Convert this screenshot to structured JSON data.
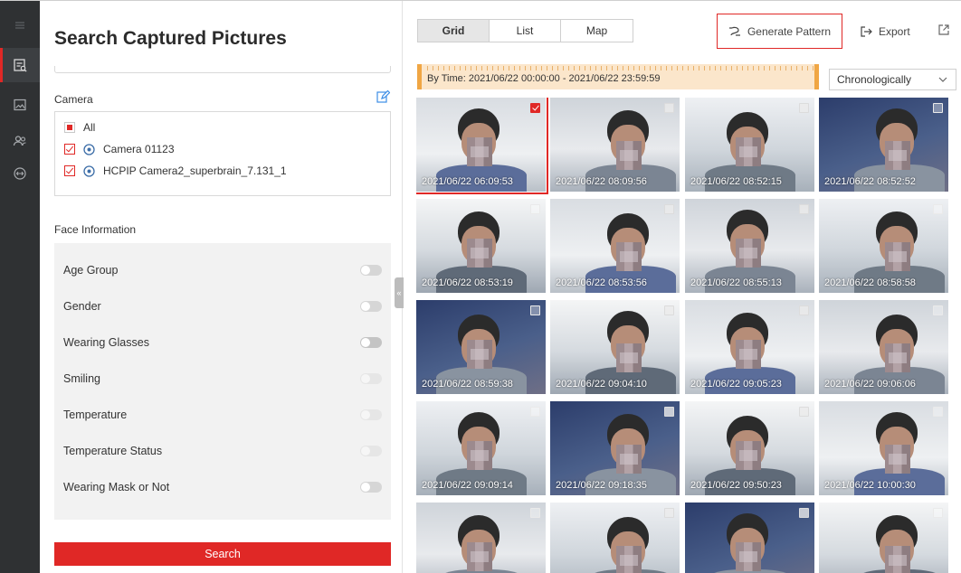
{
  "rail": {
    "items": [
      {
        "icon": "menu-icon"
      },
      {
        "icon": "search-pictures-icon",
        "active": true
      },
      {
        "icon": "image-search-icon"
      },
      {
        "icon": "person-search-icon"
      },
      {
        "icon": "face-compare-icon"
      }
    ]
  },
  "panel": {
    "title": "Search Captured Pictures",
    "camera_label": "Camera",
    "cameras": [
      {
        "label": "All",
        "state": "partial"
      },
      {
        "label": "Camera 01123",
        "state": "checked"
      },
      {
        "label": "HCPIP Camera2_superbrain_7.131_1",
        "state": "checked"
      }
    ],
    "face_info_label": "Face Information",
    "face_filters": [
      {
        "label": "Age Group",
        "enabled": true
      },
      {
        "label": "Gender",
        "enabled": true
      },
      {
        "label": "Wearing Glasses",
        "enabled": true
      },
      {
        "label": "Smiling",
        "enabled": false
      },
      {
        "label": "Temperature",
        "enabled": false
      },
      {
        "label": "Temperature Status",
        "enabled": false
      },
      {
        "label": "Wearing Mask or Not",
        "enabled": true
      }
    ],
    "search_label": "Search"
  },
  "content": {
    "tabs": [
      {
        "label": "Grid",
        "active": true
      },
      {
        "label": "List",
        "active": false
      },
      {
        "label": "Map",
        "active": false
      }
    ],
    "generate_pattern_label": "Generate Pattern",
    "export_label": "Export",
    "time_range": "By Time: 2021/06/22 00:00:00 - 2021/06/22 23:59:59",
    "sort_value": "Chronologically"
  },
  "results": [
    {
      "time": "2021/06/22 06:09:53",
      "selected": true
    },
    {
      "time": "2021/06/22 08:09:56",
      "selected": false
    },
    {
      "time": "2021/06/22 08:52:15",
      "selected": false
    },
    {
      "time": "2021/06/22 08:52:52",
      "selected": false
    },
    {
      "time": "2021/06/22 08:53:19",
      "selected": false
    },
    {
      "time": "2021/06/22 08:53:56",
      "selected": false
    },
    {
      "time": "2021/06/22 08:55:13",
      "selected": false
    },
    {
      "time": "2021/06/22 08:58:58",
      "selected": false
    },
    {
      "time": "2021/06/22 08:59:38",
      "selected": false
    },
    {
      "time": "2021/06/22 09:04:10",
      "selected": false
    },
    {
      "time": "2021/06/22 09:05:23",
      "selected": false
    },
    {
      "time": "2021/06/22 09:06:06",
      "selected": false
    },
    {
      "time": "2021/06/22 09:09:14",
      "selected": false
    },
    {
      "time": "2021/06/22 09:18:35",
      "selected": false
    },
    {
      "time": "2021/06/22 09:50:23",
      "selected": false
    },
    {
      "time": "2021/06/22 10:00:30",
      "selected": false
    },
    {
      "time": "",
      "selected": false
    },
    {
      "time": "",
      "selected": false
    },
    {
      "time": "",
      "selected": false
    },
    {
      "time": "",
      "selected": false
    }
  ],
  "colors": {
    "accent": "#e02826",
    "rail_bg": "#2f3133",
    "timebar_bg": "#fbe6cb",
    "timebar_edge": "#f0a644"
  }
}
